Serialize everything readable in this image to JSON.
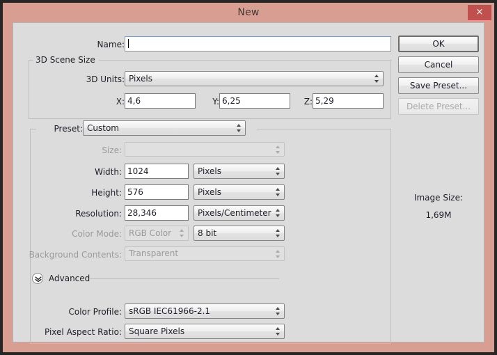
{
  "window": {
    "title": "New",
    "close_label": "×",
    "frame_color": "#d79e91",
    "close_color": "#c0504d",
    "body_color": "#dcdcdc",
    "desktop_color": "#262626"
  },
  "name_row": {
    "label": "Name:",
    "value": "",
    "placeholder": ""
  },
  "scene_group": {
    "title": "3D Scene Size",
    "units": {
      "label": "3D Units:",
      "value": "Pixels"
    },
    "axes": [
      {
        "label": "X:",
        "value": "4,6"
      },
      {
        "label": "Y:",
        "value": "6,25"
      },
      {
        "label": "Z:",
        "value": "5,29"
      }
    ]
  },
  "preset_group": {
    "title": "Preset:",
    "preset_value": "Custom",
    "rows": [
      {
        "label": "Size:",
        "value": "",
        "unit": "",
        "disabled": true
      },
      {
        "label": "Width:",
        "value": "1024",
        "unit": "Pixels",
        "disabled": false
      },
      {
        "label": "Height:",
        "value": "576",
        "unit": "Pixels",
        "disabled": false
      },
      {
        "label": "Resolution:",
        "value": "28,346",
        "unit": "Pixels/Centimeter",
        "disabled": false
      },
      {
        "label": "Color Mode:",
        "value": "RGB Color",
        "unit": "8 bit",
        "disabled": true
      },
      {
        "label": "Background Contents:",
        "value": "Transparent",
        "unit": "",
        "disabled": true
      }
    ]
  },
  "advanced": {
    "label": "Advanced",
    "icon": "chevron-double-down-icon",
    "color_profile": {
      "label": "Color Profile:",
      "value": "sRGB IEC61966-2.1"
    },
    "pixel_aspect_ratio": {
      "label": "Pixel Aspect Ratio:",
      "value": "Square Pixels"
    }
  },
  "buttons": {
    "ok": "OK",
    "cancel": "Cancel",
    "save_preset": "Save Preset...",
    "delete_preset": "Delete Preset..."
  },
  "image_size": {
    "title": "Image Size:",
    "value": "1,69M"
  }
}
